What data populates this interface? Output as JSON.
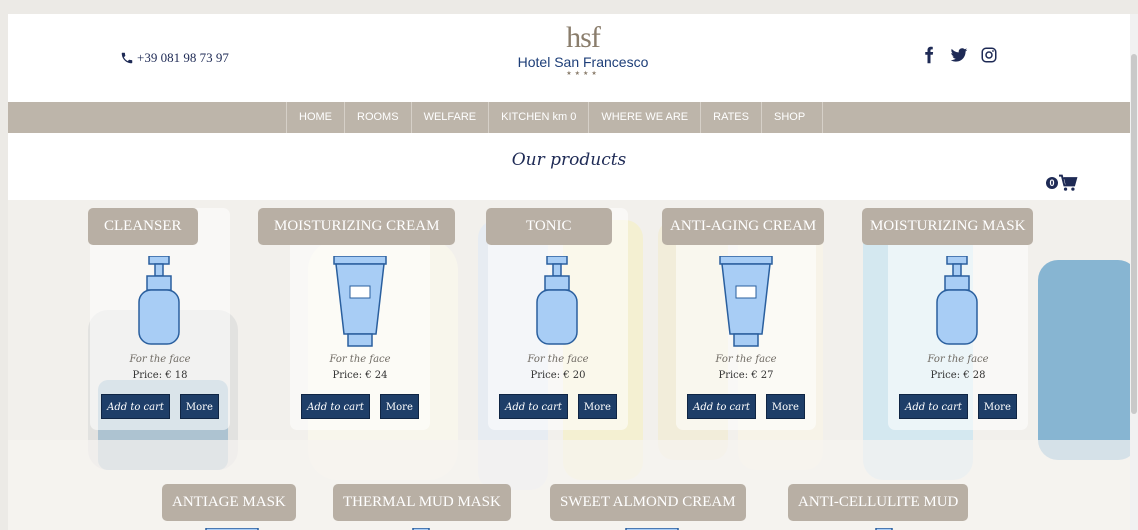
{
  "header": {
    "phone": "+39 081 98 73 97",
    "logo_mark": "hsf",
    "logo_name": "Hotel San Francesco",
    "logo_stars": "★★★★",
    "social_icons": [
      "facebook-icon",
      "twitter-icon",
      "instagram-icon"
    ]
  },
  "nav": {
    "items": [
      {
        "label": "HOME"
      },
      {
        "label": "ROOMS"
      },
      {
        "label": "WELFARE"
      },
      {
        "label": "KITCHEN km 0"
      },
      {
        "label": "WHERE WE ARE"
      },
      {
        "label": "RATES"
      },
      {
        "label": "SHOP"
      }
    ]
  },
  "main": {
    "title": "Our products",
    "cart_count": "0"
  },
  "products": [
    {
      "name": "CLEANSER",
      "category": "For the face",
      "price": "Price: € 18",
      "add_label": "Add to cart",
      "more_label": "More",
      "icon": "pump-bottle-icon"
    },
    {
      "name": "MOISTURIZING CREAM",
      "category": "For the face",
      "price": "Price: € 24",
      "add_label": "Add to cart",
      "more_label": "More",
      "icon": "tube-icon"
    },
    {
      "name": "TONIC",
      "category": "For the face",
      "price": "Price: € 20",
      "add_label": "Add to cart",
      "more_label": "More",
      "icon": "pump-bottle-icon"
    },
    {
      "name": "ANTI-AGING CREAM",
      "category": "For the face",
      "price": "Price: € 27",
      "add_label": "Add to cart",
      "more_label": "More",
      "icon": "tube-icon"
    },
    {
      "name": "MOISTURIZING MASK",
      "category": "For the face",
      "price": "Price: € 28",
      "add_label": "Add to cart",
      "more_label": "More",
      "icon": "pump-bottle-icon"
    }
  ],
  "products_row2": [
    {
      "name": "ANTIAGE MASK",
      "icon": "tube-icon"
    },
    {
      "name": "THERMAL MUD MASK",
      "icon": "pump-bottle-icon"
    },
    {
      "name": "SWEET ALMOND CREAM",
      "icon": "tube-icon"
    },
    {
      "name": "ANTI-CELLULITE MUD",
      "icon": "pump-bottle-icon"
    }
  ],
  "colors": {
    "nav_bg": "#bdb5aa",
    "title_bg": "#b8afa4",
    "button_bg": "#1e3e68",
    "icon_fill": "#a8cdf5",
    "brand_blue": "#1d3e78"
  }
}
